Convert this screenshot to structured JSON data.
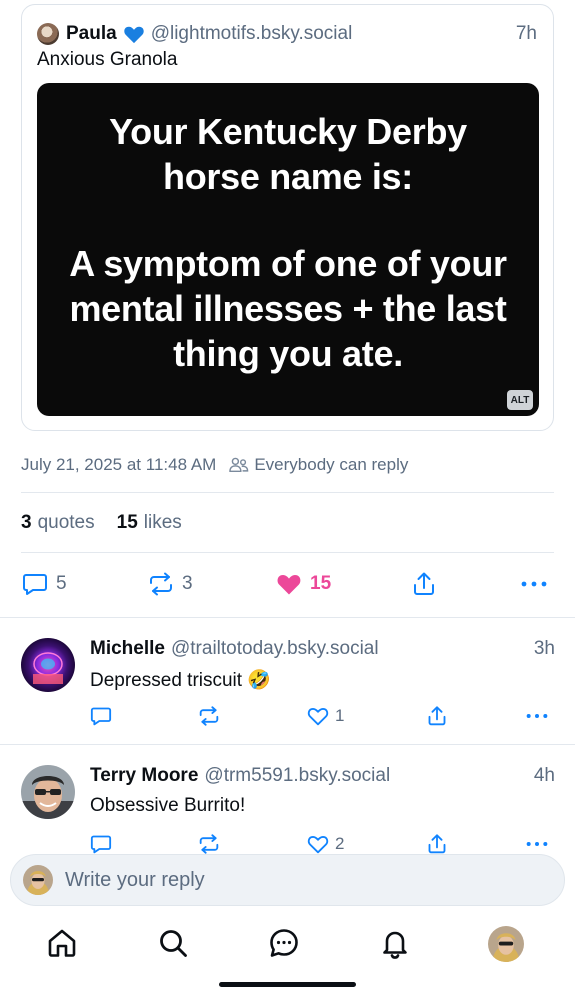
{
  "quoted_post": {
    "author_name": "Paula",
    "author_handle": "@lightmotifs.bsky.social",
    "time": "7h",
    "text": "Anxious Granola",
    "image": {
      "text_top_line1": "Your Kentucky Derby",
      "text_top_line2": "horse name is:",
      "text_bottom_line1": "A symptom of one of your",
      "text_bottom_line2": "mental illnesses + the last",
      "text_bottom_line3": "thing you ate.",
      "alt_badge": "ALT"
    }
  },
  "post_meta": {
    "timestamp": "July 21, 2025 at 11:48 AM",
    "reply_setting": "Everybody can reply"
  },
  "stats": {
    "quotes_count": "3",
    "quotes_label": "quotes",
    "likes_count": "15",
    "likes_label": "likes"
  },
  "actions": {
    "replies": "5",
    "reposts": "3",
    "likes": "15",
    "liked": true
  },
  "replies": [
    {
      "name": "Michelle",
      "handle": "@trailtotoday.bsky.social",
      "time": "3h",
      "text": "Depressed triscuit 🤣",
      "likes": "1"
    },
    {
      "name": "Terry Moore",
      "handle": "@trm5591.bsky.social",
      "time": "4h",
      "text": "Obsessive Burrito!",
      "likes": "2"
    }
  ],
  "composer": {
    "placeholder": "Write your reply"
  },
  "colors": {
    "accent_like": "#ec4899",
    "muted_text": "#5c6c80",
    "icon_blue": "#1083fe"
  }
}
